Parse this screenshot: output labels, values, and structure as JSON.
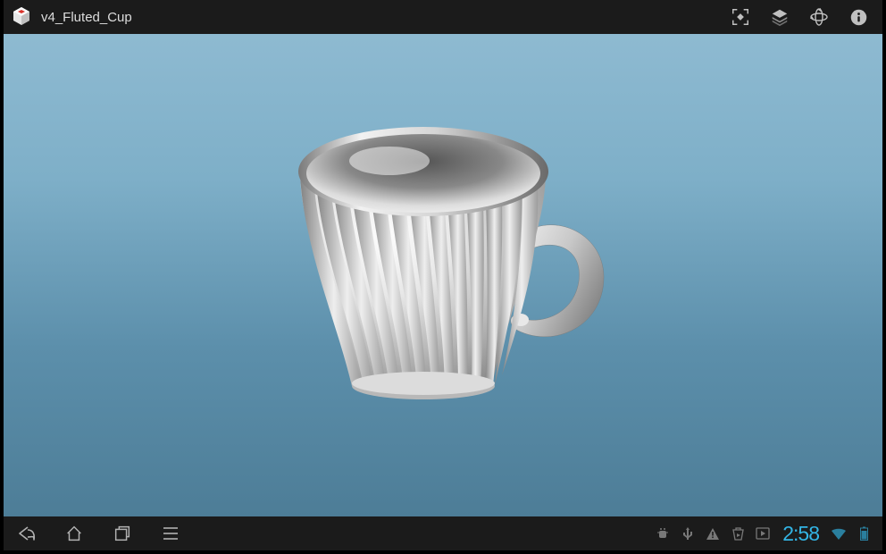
{
  "appBar": {
    "title": "v4_Fluted_Cup"
  },
  "statusBar": {
    "time": "2:58"
  }
}
